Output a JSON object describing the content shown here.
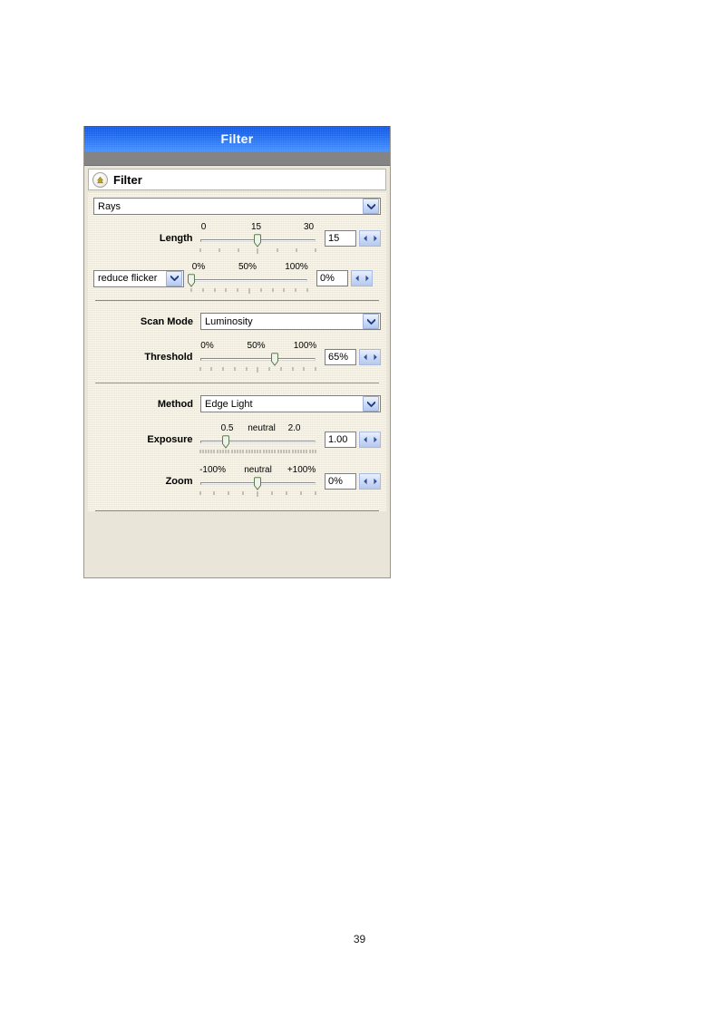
{
  "page": {
    "number": "39"
  },
  "window": {
    "title": "Filter"
  },
  "panel": {
    "header_title": "Filter",
    "collapse_icon": "collapse-chevron-icon"
  },
  "preset": {
    "label": "preset-select",
    "value": "Rays",
    "dropdown_icon": "chevron-down-icon"
  },
  "controls": {
    "length": {
      "label": "Length",
      "value": "15",
      "scale": [
        "0",
        "15",
        "30"
      ],
      "min": 0,
      "max": 30,
      "thumb_percent": 50,
      "tick_count": 7,
      "spin_prev_icon": "triangle-left-icon",
      "spin_next_icon": "triangle-right-icon"
    },
    "reduce_flicker": {
      "label": "reduce flicker",
      "value": "0%",
      "scale": [
        "0%",
        "50%",
        "100%"
      ],
      "min": 0,
      "max": 100,
      "thumb_percent": 0,
      "tick_count": 11,
      "dropdown_icon": "chevron-down-icon",
      "spin_prev_icon": "triangle-left-icon",
      "spin_next_icon": "triangle-right-icon"
    },
    "scan_mode": {
      "label": "Scan Mode",
      "value": "Luminosity",
      "dropdown_icon": "chevron-down-icon"
    },
    "threshold": {
      "label": "Threshold",
      "value": "65%",
      "scale": [
        "0%",
        "50%",
        "100%"
      ],
      "min": 0,
      "max": 100,
      "thumb_percent": 65,
      "tick_count": 11,
      "spin_prev_icon": "triangle-left-icon",
      "spin_next_icon": "triangle-right-icon"
    },
    "method": {
      "label": "Method",
      "value": "Edge Light",
      "dropdown_icon": "chevron-down-icon"
    },
    "exposure": {
      "label": "Exposure",
      "value": "1.00",
      "scale": [
        "0.5",
        "neutral",
        "2.0"
      ],
      "min": 0.5,
      "max": 2.0,
      "thumb_percent": 22,
      "tick_count": 41,
      "spin_prev_icon": "triangle-left-icon",
      "spin_next_icon": "triangle-right-icon"
    },
    "zoom": {
      "label": "Zoom",
      "value": "0%",
      "scale": [
        "-100%",
        "neutral",
        "+100%"
      ],
      "min": -100,
      "max": 100,
      "thumb_percent": 50,
      "tick_count": 9,
      "spin_prev_icon": "triangle-left-icon",
      "spin_next_icon": "triangle-right-icon"
    }
  },
  "colors": {
    "titlebar_blue": "#1766ef",
    "panel_beige": "#e9e5d8",
    "toolbar_gray": "#848484",
    "spinner_blue": "#ccd9f4",
    "thumb_green": "#e8f0e2"
  }
}
